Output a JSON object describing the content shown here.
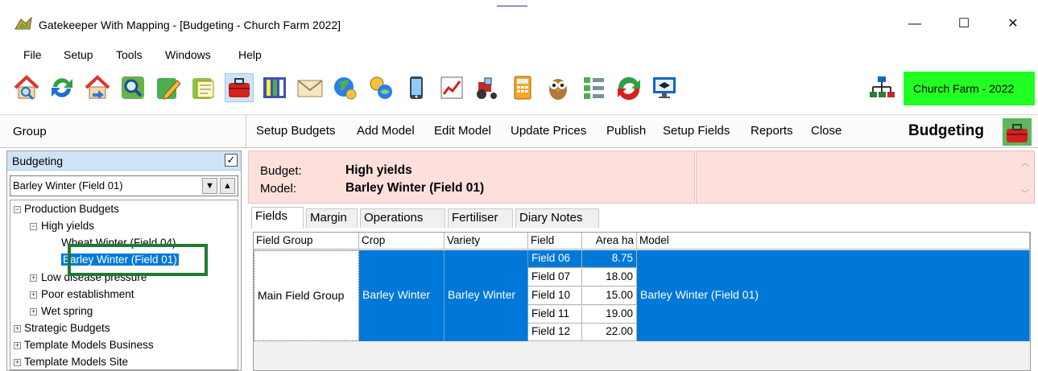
{
  "window": {
    "title": "Gatekeeper With Mapping - [Budgeting - Church Farm 2022]",
    "controls": {
      "minimize": "—",
      "maximize": "☐",
      "close": "✕"
    }
  },
  "menu": [
    "File",
    "Setup",
    "Tools",
    "Windows",
    "Help"
  ],
  "toolbar": {
    "icons": [
      "home-search-icon",
      "sync-arrows-icon",
      "home-arrow-icon",
      "magnifier-icon",
      "edit-pencil-icon",
      "notepad-icon",
      "budget-toolbox-icon",
      "columns-icon",
      "envelope-icon",
      "globe-icon",
      "mobile-phone-icon",
      "line-chart-icon",
      "tractor-icon",
      "calculator-icon",
      "owl-icon",
      "checklist-icon",
      "recycle-arrows-icon",
      "training-monitor-icon"
    ],
    "network_icon": "network-tree-icon",
    "farm": "Church Farm - 2022"
  },
  "groupbar": {
    "label": "Group",
    "actions": [
      "Setup Budgets",
      "Add Model",
      "Edit Model",
      "Update Prices",
      "Publish",
      "Setup Fields",
      "Reports",
      "Close"
    ],
    "module_title": "Budgeting"
  },
  "left_panel": {
    "header": "Budgeting",
    "header_checked": "✓",
    "selected_model": "Barley Winter (Field 01)",
    "tree": {
      "production_budgets": "Production Budgets",
      "high_yields": "High yields",
      "wheat_winter": "Wheat Winter (Field 04)",
      "barley_winter": "Barley Winter (Field 01)",
      "low_disease": "Low disease pressure",
      "poor_establishment": "Poor establishment",
      "wet_spring": "Wet spring",
      "strategic": "Strategic Budgets",
      "template_business": "Template Models Business",
      "template_site": "Template Models Site"
    }
  },
  "info": {
    "budget_label": "Budget:",
    "budget_value": "High yields",
    "model_label": "Model:",
    "model_value": "Barley Winter (Field 01)"
  },
  "tabs": [
    "Fields",
    "Margin",
    "Operations",
    "Fertiliser",
    "Diary Notes"
  ],
  "grid": {
    "columns": [
      "Field Group",
      "Crop",
      "Variety",
      "Field",
      "Area ha",
      "Model"
    ],
    "field_group": "Main Field Group",
    "crop": "Barley Winter",
    "variety": "Barley Winter",
    "model": "Barley Winter (Field 01)",
    "rows": [
      {
        "field": "Field 06",
        "area": "8.75"
      },
      {
        "field": "Field 07",
        "area": "18.00"
      },
      {
        "field": "Field 10",
        "area": "15.00"
      },
      {
        "field": "Field 11",
        "area": "19.00"
      },
      {
        "field": "Field 12",
        "area": "22.00"
      }
    ]
  },
  "colors": {
    "selection": "#0078d7",
    "farm_badge": "#22ff22",
    "info_bg": "#fde0dc",
    "highlight_box": "#1f7a34"
  }
}
